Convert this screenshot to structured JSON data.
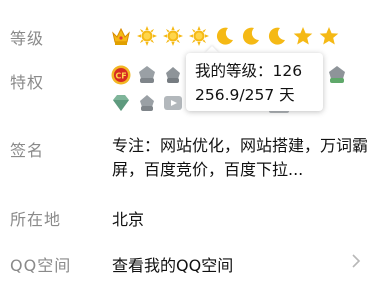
{
  "level": {
    "label": "等级",
    "icons": [
      "crown-icon",
      "sun-icon",
      "sun-icon",
      "sun-icon",
      "moon-icon",
      "moon-icon",
      "moon-icon",
      "star-icon",
      "star-icon"
    ]
  },
  "privileges": {
    "label": "特权",
    "icons_row1": [
      "qq-game-badge-icon",
      "privilege-badge-icon",
      "privilege-badge-icon",
      "privilege-badge-icon",
      "privilege-badge-icon",
      "privilege-badge-icon",
      "privilege-badge-icon",
      "privilege-badge-icon",
      "privilege-badge-icon",
      "privilege-badge-icon"
    ],
    "icons_row2": [
      "diamond-badge-icon",
      "privilege-badge-icon",
      "video-badge-icon",
      "privilege-badge-icon",
      "privilege-badge-icon",
      "privilege-badge-icon",
      "privilege-badge-icon",
      "privilege-badge-icon"
    ]
  },
  "tooltip": {
    "level_line": "我的等级：126",
    "days_line": "256.9/257 天"
  },
  "signature": {
    "label": "签名",
    "text": "专注：网站优化，网站搭建，万词霸屏，百度竞价，百度下拉..."
  },
  "location": {
    "label": "所在地",
    "value": "北京"
  },
  "qzone": {
    "label": "QQ空间",
    "link_text": "查看我的QQ空间",
    "chevron": "chevron-right-icon"
  },
  "colors": {
    "label": "#8a8a8a",
    "text": "#111111",
    "gold": "#f5b915",
    "badge_gray": "#8e9499"
  }
}
